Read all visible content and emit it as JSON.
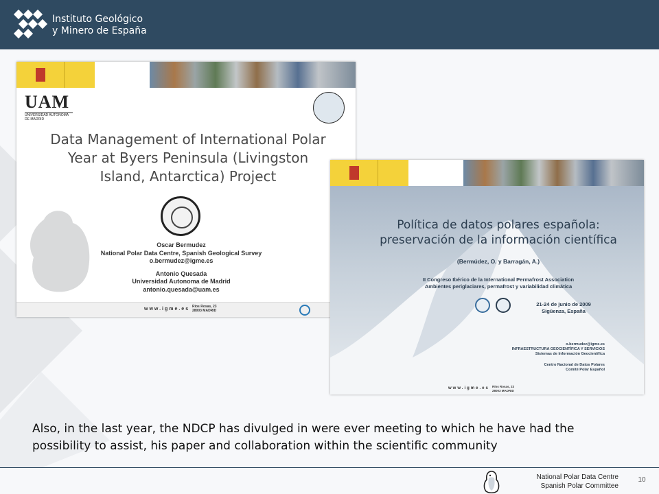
{
  "header": {
    "org_line1": "Instituto Geológico",
    "org_line2": "y Minero de España",
    "logo_icon": "igme-logo-icon",
    "background_color": "#2f4a61"
  },
  "slide1": {
    "university_abbrev": "UAM",
    "university_name": "UNIVERSIDAD AUTONOMA DE MADRID",
    "title_line1": "Data Management of International Polar",
    "title_line2": "Year at Byers Peninsula (Livingston",
    "title_line3": "Island, Antarctica) Project",
    "author1_name": "Oscar Bermudez",
    "author1_affiliation": "National Polar Data Centre, Spanish Geological Survey",
    "author1_email": "o.bermudez@igme.es",
    "author2_name": "Antonio Quesada",
    "author2_affiliation": "Universidad Autonoma de Madrid",
    "author2_email": "antonio.quesada@uam.es",
    "footer_web": "www.igme.es",
    "footer_address_line1": "Ríos Rosas, 23",
    "footer_address_line2": "28003 MADRID"
  },
  "slide2": {
    "title_line1": "Política de datos polares española:",
    "title_line2": "preservación de la información científica",
    "authors": "(Bermúdez, O. y Barragán, A.)",
    "conference_line1": "II Congreso Ibérico de la International Permafrost Association",
    "conference_line2": "Ambientes periglaciares, permafrost y variabilidad climática",
    "date_line1": "21-24 de junio de 2009",
    "date_line2": "Sigüenza, España",
    "contact_line1": "o.bermudez@igme.es",
    "contact_line2": "INFRAESTRUCTURA GEOCIENTÍFICA Y SERVICIOS",
    "contact_line3": "Sistemas de Información Geocientífica",
    "contact_line4": "Centro Nacional de Datos Polares",
    "contact_line5": "Comité Polar Español",
    "footer_web": "www.igme.es",
    "footer_address_line1": "Ríos Rosas, 23",
    "footer_address_line2": "28003 MADRID"
  },
  "caption": "Also, in the last year, the NDCP has divulged in were ever meeting to which he have had the possibility to assist, his paper and collaboration within the scientific community",
  "footer": {
    "line1": "National Polar Data Centre",
    "line2": "Spanish Polar Committee",
    "page_number": "10",
    "logo_icon": "penguin-logo-icon"
  }
}
